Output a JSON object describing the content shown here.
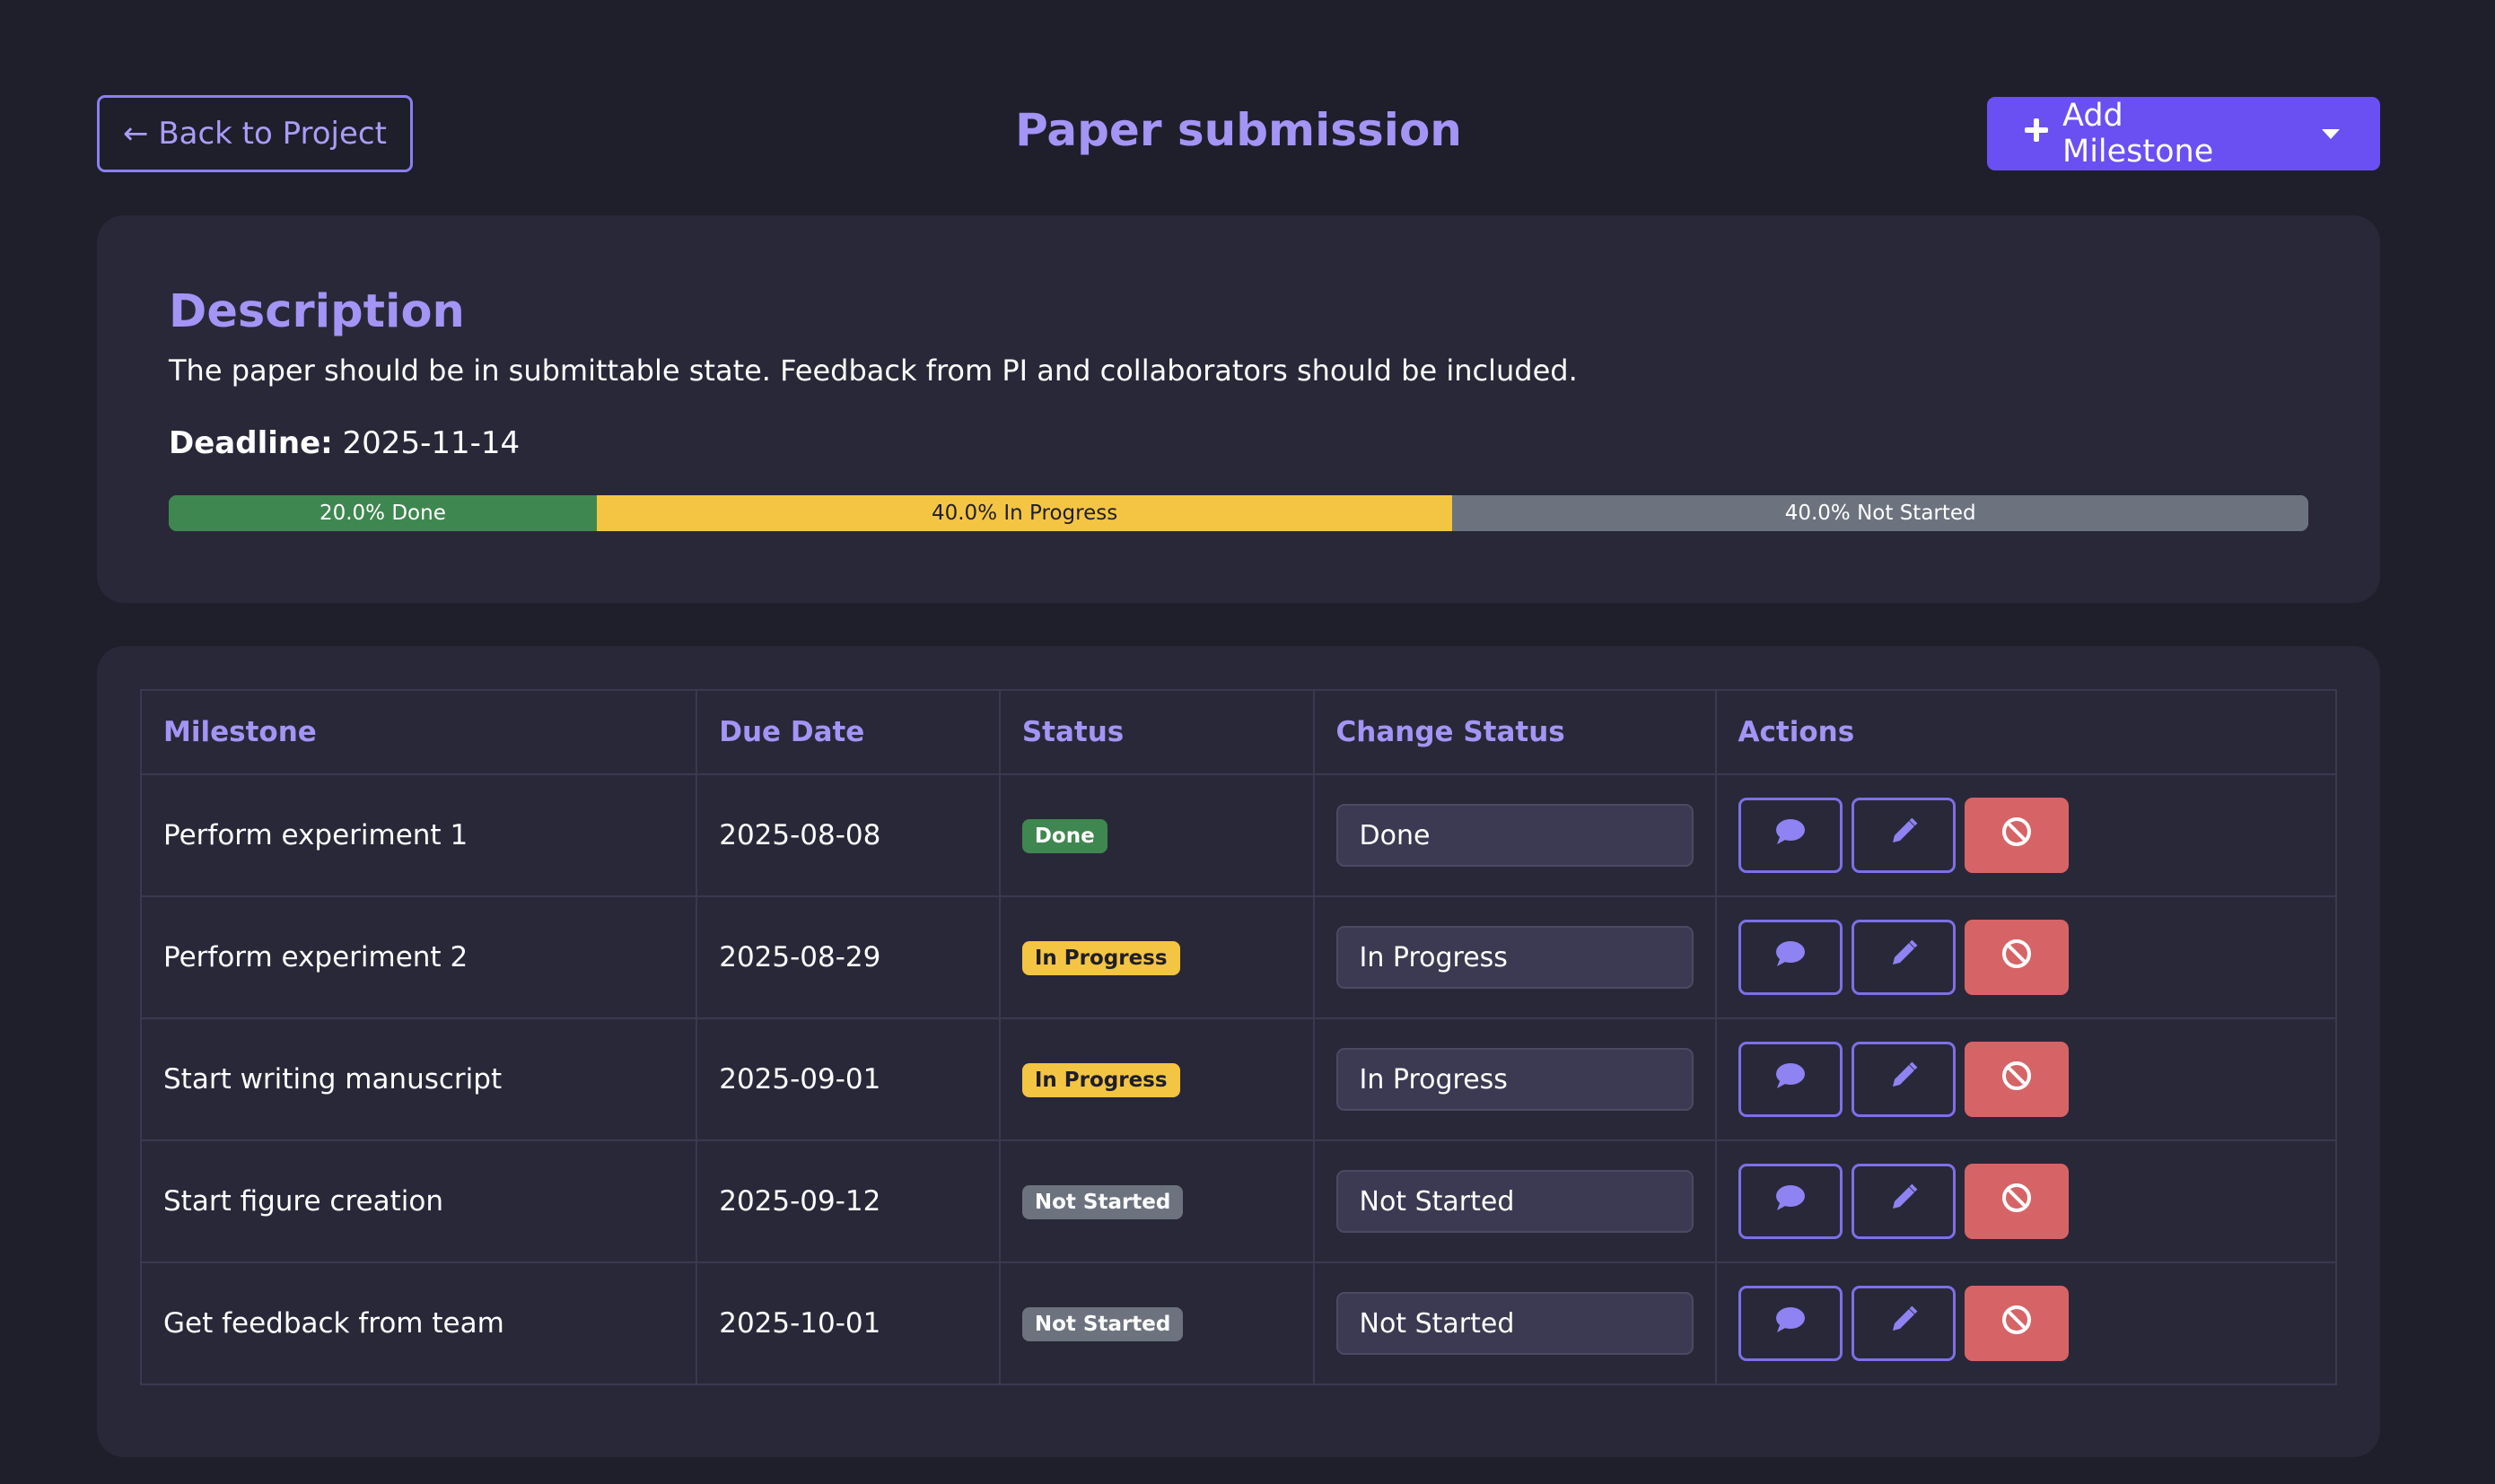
{
  "header": {
    "back_label": "← Back to Project",
    "title": "Paper submission",
    "add_label": "Add Milestone"
  },
  "description": {
    "heading": "Description",
    "body": "The paper should be in submittable state. Feedback from PI and collaborators should be included.",
    "deadline_label": "Deadline:",
    "deadline_value": "2025-11-14"
  },
  "progress": {
    "segments": [
      {
        "label": "20.0% Done",
        "percent": 20.0,
        "color": "#3f8750"
      },
      {
        "label": "40.0% In Progress",
        "percent": 40.0,
        "color": "#f4c542"
      },
      {
        "label": "40.0% Not Started",
        "percent": 40.0,
        "color": "#6c737e"
      }
    ]
  },
  "table": {
    "headers": [
      "Milestone",
      "Due Date",
      "Status",
      "Change Status",
      "Actions"
    ],
    "rows": [
      {
        "milestone": "Perform experiment 1",
        "due": "2025-08-08",
        "status": "Done",
        "change": "Done"
      },
      {
        "milestone": "Perform experiment 2",
        "due": "2025-08-29",
        "status": "In Progress",
        "change": "In Progress"
      },
      {
        "milestone": "Start writing manuscript",
        "due": "2025-09-01",
        "status": "In Progress",
        "change": "In Progress"
      },
      {
        "milestone": "Start figure creation",
        "due": "2025-09-12",
        "status": "Not Started",
        "change": "Not Started"
      },
      {
        "milestone": "Get feedback from team",
        "due": "2025-10-01",
        "status": "Not Started",
        "change": "Not Started"
      }
    ]
  },
  "colors": {
    "accent": "#a394f5",
    "primary_button": "#6a4ff3",
    "danger": "#d66466",
    "done": "#3f8750",
    "in_progress": "#f4c542",
    "not_started": "#6c737e"
  },
  "icons": {
    "back": "arrow-left-icon",
    "add": "plus-icon",
    "caret": "chevron-down-icon",
    "comment": "comment-icon",
    "edit": "pencil-icon",
    "delete": "ban-icon"
  }
}
